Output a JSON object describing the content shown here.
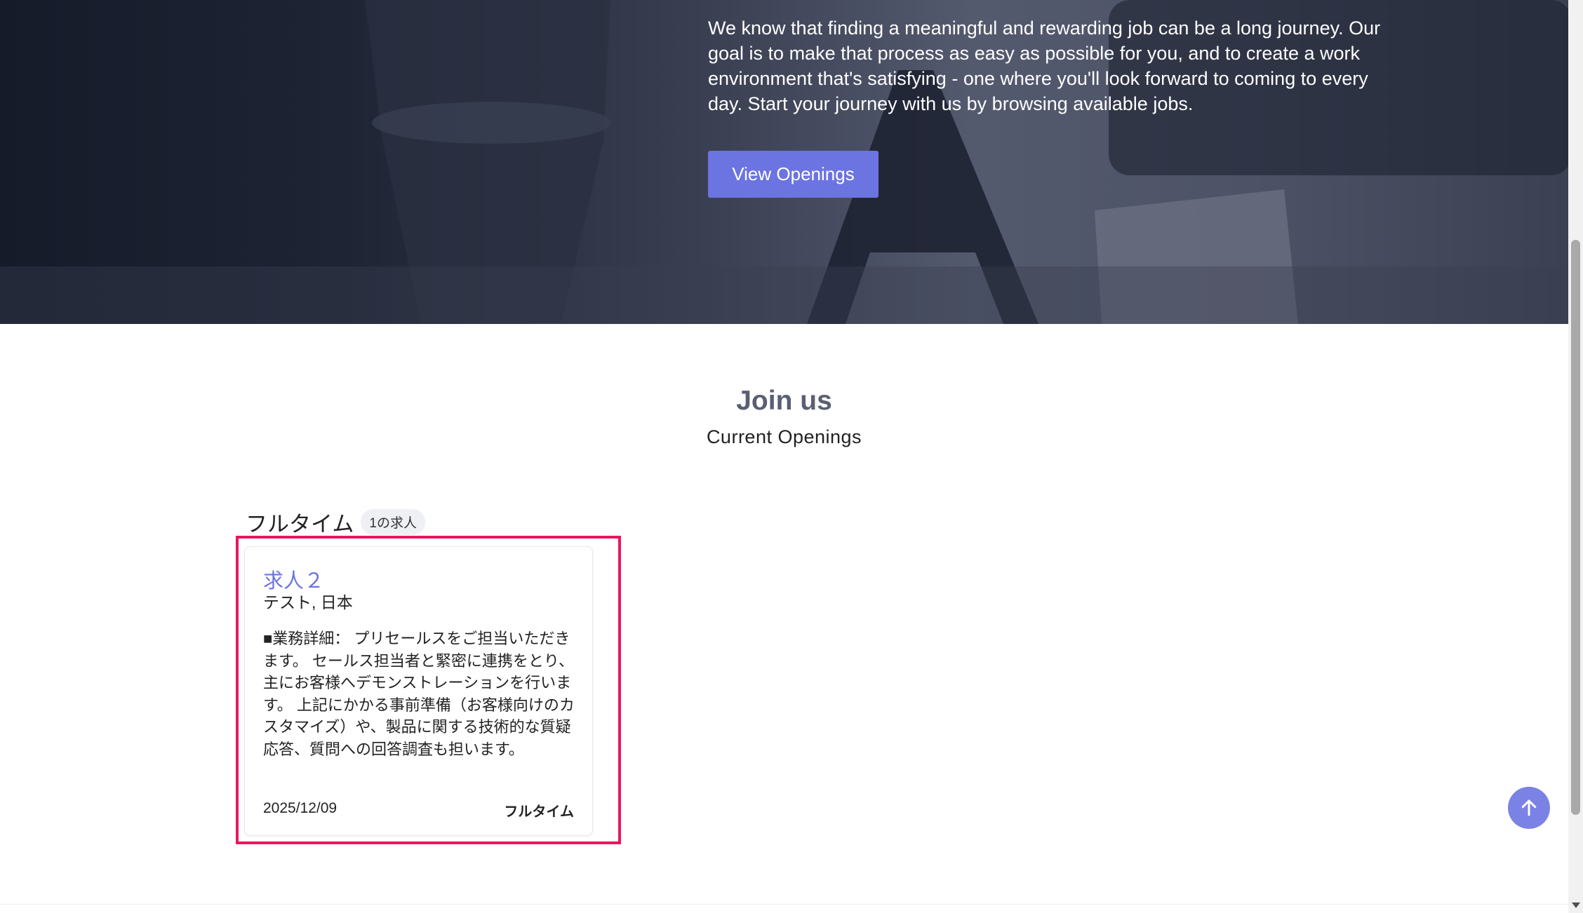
{
  "hero": {
    "description": "We know that finding a meaningful and rewarding job can be a long journey. Our goal is to make that process as easy as possible for you, and to create a work environment that's satisfying - one where you'll look forward to coming to every day. Start your journey with us by browsing available jobs.",
    "button_label": "View Openings"
  },
  "section": {
    "title": "Join us",
    "subtitle": "Current Openings"
  },
  "groups": [
    {
      "name": "フルタイム",
      "count": "1の求人",
      "jobs": [
        {
          "title": "求人２",
          "location": "テスト, 日本",
          "description": "■業務詳細： プリセールスをご担当いただきます。 セールス担当者と緊密に連携をとり、主にお客様へデモンストレーションを行います。 上記にかかる事前準備（お客様向けのカスタマイズ）や、製品に関する技術的な質疑応答、質問への回答調査も担います。",
          "date": "2025/12/09",
          "type": "フルタイム"
        }
      ]
    }
  ],
  "colors": {
    "accent": "#6b74e0",
    "highlight": "#e8175d",
    "scroll_top_button": "#7b82e6"
  },
  "icons": {
    "scroll_top": "arrow-up-icon"
  }
}
